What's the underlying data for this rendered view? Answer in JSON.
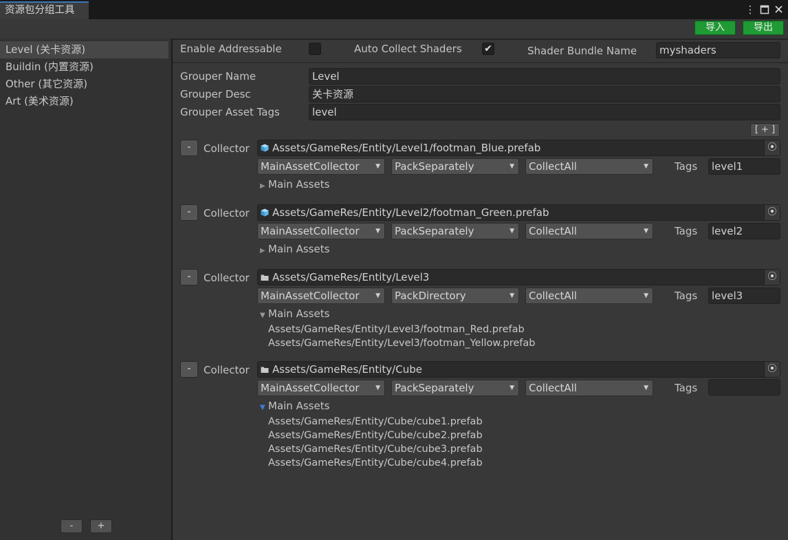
{
  "window": {
    "title": "资源包分组工具",
    "menu_icon": "kebab-menu-icon",
    "maximize_icon": "maximize-icon",
    "close_icon": "close-icon"
  },
  "toolbar": {
    "import_label": "导入",
    "export_label": "导出",
    "accent_color": "#1f9a34"
  },
  "sidebar": {
    "items": [
      {
        "label": "Level (关卡资源)",
        "selected": true
      },
      {
        "label": "Buildin (内置资源)",
        "selected": false
      },
      {
        "label": "Other (其它资源)",
        "selected": false
      },
      {
        "label": "Art (美术资源)",
        "selected": false
      }
    ],
    "remove_label": "-",
    "add_label": "+"
  },
  "settings": {
    "enable_addressable_label": "Enable Addressable",
    "enable_addressable": false,
    "auto_collect_shaders_label": "Auto Collect Shaders",
    "auto_collect_shaders": true,
    "shader_bundle_name_label": "Shader Bundle Name",
    "shader_bundle_name": "myshaders"
  },
  "grouper": {
    "name_label": "Grouper Name",
    "name": "Level",
    "desc_label": "Grouper Desc",
    "desc": "关卡资源",
    "tags_label": "Grouper Asset Tags",
    "tags": "level",
    "add_collector_label": "[ + ]"
  },
  "collectors": [
    {
      "remove_label": "-",
      "label": "Collector",
      "icon": "prefab-icon",
      "path": "Assets/GameRes/Entity/Level1/footman_Blue.prefab",
      "collector_type": "MainAssetCollector",
      "pack_rule": "PackSeparately",
      "filter_rule": "CollectAll",
      "tags_label": "Tags",
      "tags": "level1",
      "foldout_label": "Main Assets",
      "expanded": false,
      "assets": []
    },
    {
      "remove_label": "-",
      "label": "Collector",
      "icon": "prefab-icon",
      "path": "Assets/GameRes/Entity/Level2/footman_Green.prefab",
      "collector_type": "MainAssetCollector",
      "pack_rule": "PackSeparately",
      "filter_rule": "CollectAll",
      "tags_label": "Tags",
      "tags": "level2",
      "foldout_label": "Main Assets",
      "expanded": false,
      "assets": []
    },
    {
      "remove_label": "-",
      "label": "Collector",
      "icon": "folder-icon",
      "path": "Assets/GameRes/Entity/Level3",
      "collector_type": "MainAssetCollector",
      "pack_rule": "PackDirectory",
      "filter_rule": "CollectAll",
      "tags_label": "Tags",
      "tags": "level3",
      "foldout_label": "Main Assets",
      "expanded": true,
      "assets": [
        "Assets/GameRes/Entity/Level3/footman_Red.prefab",
        "Assets/GameRes/Entity/Level3/footman_Yellow.prefab"
      ]
    },
    {
      "remove_label": "-",
      "label": "Collector",
      "icon": "folder-icon",
      "path": "Assets/GameRes/Entity/Cube",
      "collector_type": "MainAssetCollector",
      "pack_rule": "PackSeparately",
      "filter_rule": "CollectAll",
      "tags_label": "Tags",
      "tags": "",
      "foldout_label": "Main Assets",
      "expanded": true,
      "assets": [
        "Assets/GameRes/Entity/Cube/cube1.prefab",
        "Assets/GameRes/Entity/Cube/cube2.prefab",
        "Assets/GameRes/Entity/Cube/cube3.prefab",
        "Assets/GameRes/Entity/Cube/cube4.prefab"
      ]
    }
  ]
}
